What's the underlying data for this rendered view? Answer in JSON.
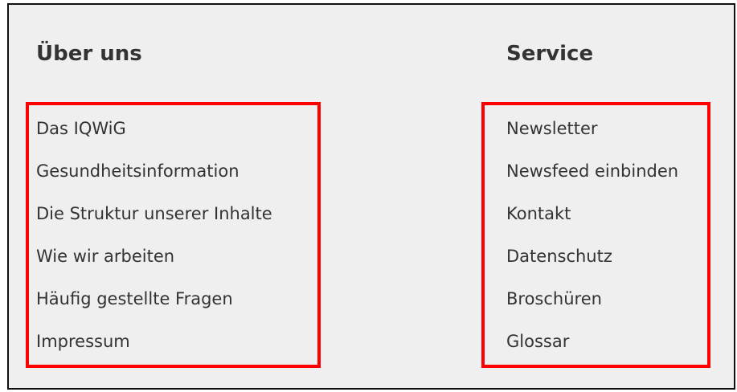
{
  "footer": {
    "about": {
      "heading": "Über uns",
      "links": [
        "Das IQWiG",
        "Gesundheitsinformation",
        "Die Struktur unserer Inhalte",
        "Wie wir arbeiten",
        "Häufig gestellte Fragen",
        "Impressum"
      ]
    },
    "service": {
      "heading": "Service",
      "links": [
        "Newsletter",
        "Newsfeed einbinden",
        "Kontakt",
        "Datenschutz",
        "Broschüren",
        "Glossar"
      ]
    }
  },
  "colors": {
    "background": "#efefef",
    "text": "#333333",
    "highlight_border": "#ff0000",
    "frame_border": "#111111"
  }
}
